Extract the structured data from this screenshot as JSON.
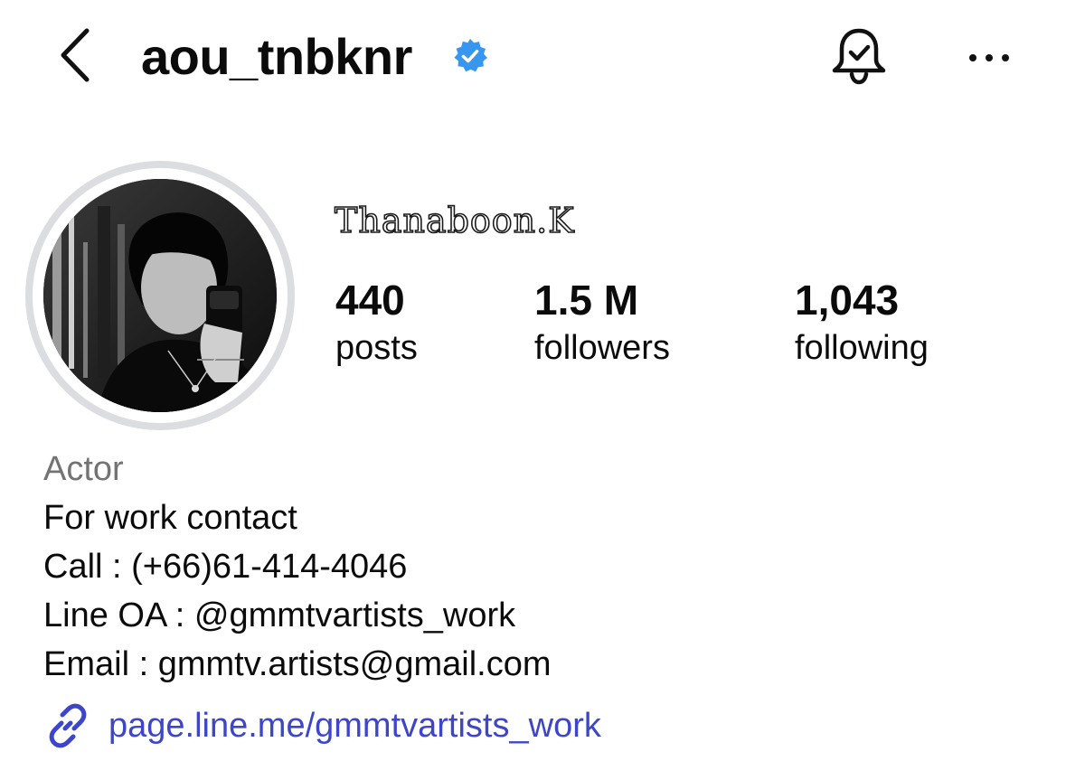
{
  "header": {
    "username": "aou_tnbknr",
    "back_icon": "chevron-left-icon",
    "verified_icon": "verified-badge-icon",
    "bell_icon": "notification-bell-icon",
    "more_icon": "more-horizontal-icon"
  },
  "profile": {
    "display_name": "Thanaboon.K",
    "avatar": "profile-avatar"
  },
  "stats": {
    "posts": {
      "value": "440",
      "label": "posts"
    },
    "followers": {
      "value": "1.5 M",
      "label": "followers"
    },
    "following": {
      "value": "1,043",
      "label": "following"
    }
  },
  "bio": {
    "category": "Actor",
    "lines": [
      "For work contact",
      "Call : (+66)61-414-4046",
      "Line OA : @gmmtvartists_work",
      "Email : gmmtv.artists@gmail.com"
    ]
  },
  "link": {
    "icon": "link-icon",
    "text": "page.line.me/gmmtvartists_work"
  },
  "colors": {
    "link": "#3d46c8",
    "category": "#737373",
    "verified": "#3797f0",
    "ring": "#dcdde0"
  }
}
